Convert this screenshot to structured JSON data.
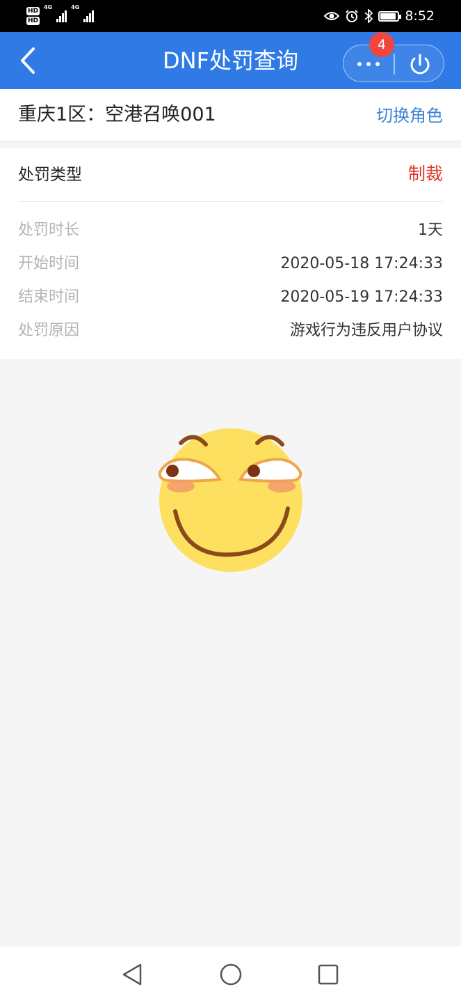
{
  "status_bar": {
    "hd1": "HD",
    "hd2": "HD",
    "net1": "4G",
    "net2": "4G",
    "time": "8:52",
    "icons": [
      "eye-icon",
      "alarm-icon",
      "bluetooth-icon",
      "battery-icon"
    ]
  },
  "header": {
    "title": "DNF处罚查询",
    "badge_count": "4",
    "background": "#2f7ae5"
  },
  "role": {
    "name": "重庆1区：空港召唤001",
    "switch_label": "切换角色"
  },
  "penalty": {
    "type_label": "处罚类型",
    "type_value": "制裁",
    "type_color": "#e0352b",
    "rows": [
      {
        "label": "处罚时长",
        "value": "1天"
      },
      {
        "label": "开始时间",
        "value": "2020-05-18 17:24:33"
      },
      {
        "label": "结束时间",
        "value": "2020-05-19 17:24:33"
      },
      {
        "label": "处罚原因",
        "value": "游戏行为违反用户协议"
      }
    ]
  },
  "illustration": {
    "icon": "smirk-emoji-icon"
  },
  "navbar": {
    "icons": [
      "back-triangle-icon",
      "home-circle-icon",
      "recents-square-icon"
    ]
  }
}
